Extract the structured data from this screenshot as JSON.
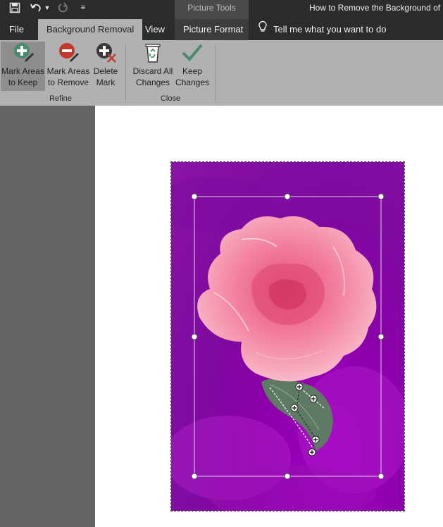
{
  "title_bar": {
    "contextual_tab": "Picture Tools",
    "document_title": "How to Remove the Background of a"
  },
  "tabs": {
    "file": "File",
    "background_removal": "Background Removal",
    "view": "View",
    "picture_format": "Picture Format",
    "tell_me": "Tell me what you want to do"
  },
  "ribbon": {
    "mark_keep": [
      "Mark Areas",
      "to Keep"
    ],
    "mark_remove": [
      "Mark Areas",
      "to Remove"
    ],
    "delete_mark": [
      "Delete",
      "Mark"
    ],
    "discard_all": [
      "Discard All",
      "Changes"
    ],
    "keep_changes": [
      "Keep",
      "Changes"
    ],
    "group_refine": "Refine",
    "group_close": "Close"
  },
  "colors": {
    "accent_keep": "#4a8a6e",
    "accent_remove": "#c0392b",
    "removal_overlay": "#8b13a6"
  }
}
